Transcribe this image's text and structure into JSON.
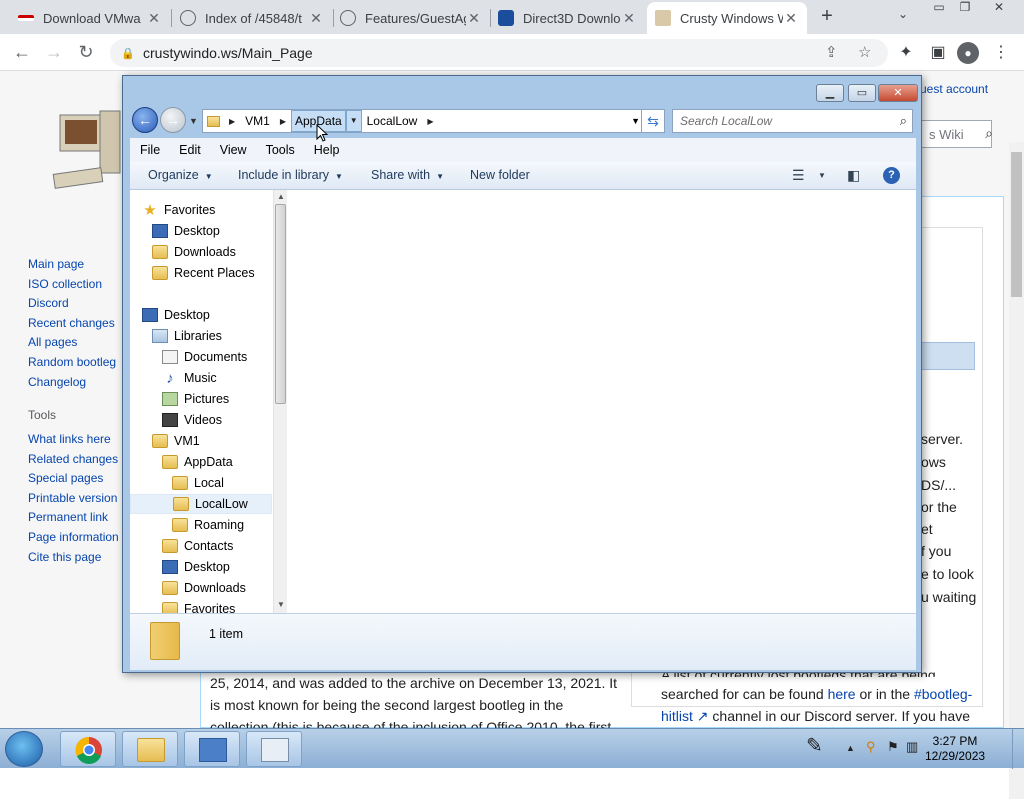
{
  "browser": {
    "tabs": [
      {
        "label": "Download VMwa",
        "active": false
      },
      {
        "label": "Index of /45848/t",
        "active": false
      },
      {
        "label": "Features/GuestAg",
        "active": false
      },
      {
        "label": "Direct3D Downlo",
        "active": false
      },
      {
        "label": "Crusty Windows W",
        "active": true
      }
    ],
    "url": "crustywindo.ws/Main_Page"
  },
  "wiki": {
    "account": "uest account",
    "search_partial": "s Wiki",
    "nav": [
      "Main page",
      "ISO collection",
      "Discord",
      "Recent changes",
      "All pages",
      "Random bootleg",
      "Changelog"
    ],
    "tools_heading": "Tools",
    "tools": [
      "What links here",
      "Related changes",
      "Special pages",
      "Printable version",
      "Permanent link",
      "Page information",
      "Cite this page"
    ],
    "right_snippets": [
      "server.",
      "ows",
      "DS/...",
      "or the",
      "et",
      "f you",
      "e to look",
      "u waiting"
    ],
    "body_left": [
      "25, 2014, and was added to the archive on December 13, 2021. It",
      "is most known for being the second largest bootleg in the",
      "collection (this is because of the inclusion of Office 2010, the first"
    ],
    "body_right_1": "A list of currently lost bootlegs that are being",
    "body_right_2a": "searched for can be found ",
    "body_right_2b": "here",
    "body_right_2c": " or in the ",
    "body_right_2d": "#bootleg-",
    "body_right_3a": "hitlist",
    "body_right_3b": " channel in our Discord server. If you have"
  },
  "explorer": {
    "breadcrumb": [
      "VM1",
      "AppData",
      "LocalLow"
    ],
    "search_placeholder": "Search LocalLow",
    "menu": [
      "File",
      "Edit",
      "View",
      "Tools",
      "Help"
    ],
    "commands": [
      "Organize",
      "Include in library",
      "Share with",
      "New folder"
    ],
    "nav_tree": [
      {
        "label": "Favorites",
        "icon": "star-icon",
        "indent": 0
      },
      {
        "label": "Desktop",
        "icon": "desktop-icon",
        "indent": 1
      },
      {
        "label": "Downloads",
        "icon": "downloads-folder-icon",
        "indent": 1
      },
      {
        "label": "Recent Places",
        "icon": "recent-places-icon",
        "indent": 1
      },
      {
        "label": "Desktop",
        "icon": "desktop-icon",
        "indent": 0
      },
      {
        "label": "Libraries",
        "icon": "libraries-icon",
        "indent": 1
      },
      {
        "label": "Documents",
        "icon": "documents-icon",
        "indent": 2
      },
      {
        "label": "Music",
        "icon": "music-icon",
        "indent": 2
      },
      {
        "label": "Pictures",
        "icon": "pictures-icon",
        "indent": 2
      },
      {
        "label": "Videos",
        "icon": "videos-icon",
        "indent": 2
      },
      {
        "label": "VM1",
        "icon": "user-folder-icon",
        "indent": 1
      },
      {
        "label": "AppData",
        "icon": "folder-icon",
        "indent": 2
      },
      {
        "label": "Local",
        "icon": "folder-icon",
        "indent": 3
      },
      {
        "label": "LocalLow",
        "icon": "folder-icon",
        "indent": 3,
        "selected": true
      },
      {
        "label": "Roaming",
        "icon": "folder-icon",
        "indent": 3
      },
      {
        "label": "Contacts",
        "icon": "contacts-icon",
        "indent": 2
      },
      {
        "label": "Desktop",
        "icon": "desktop-icon",
        "indent": 2
      },
      {
        "label": "Downloads",
        "icon": "downloads-folder-icon",
        "indent": 2
      },
      {
        "label": "Favorites",
        "icon": "favorites-folder-icon",
        "indent": 2
      }
    ],
    "status": "1 item"
  },
  "taskbar": {
    "time": "3:27 PM",
    "date": "12/29/2023"
  }
}
